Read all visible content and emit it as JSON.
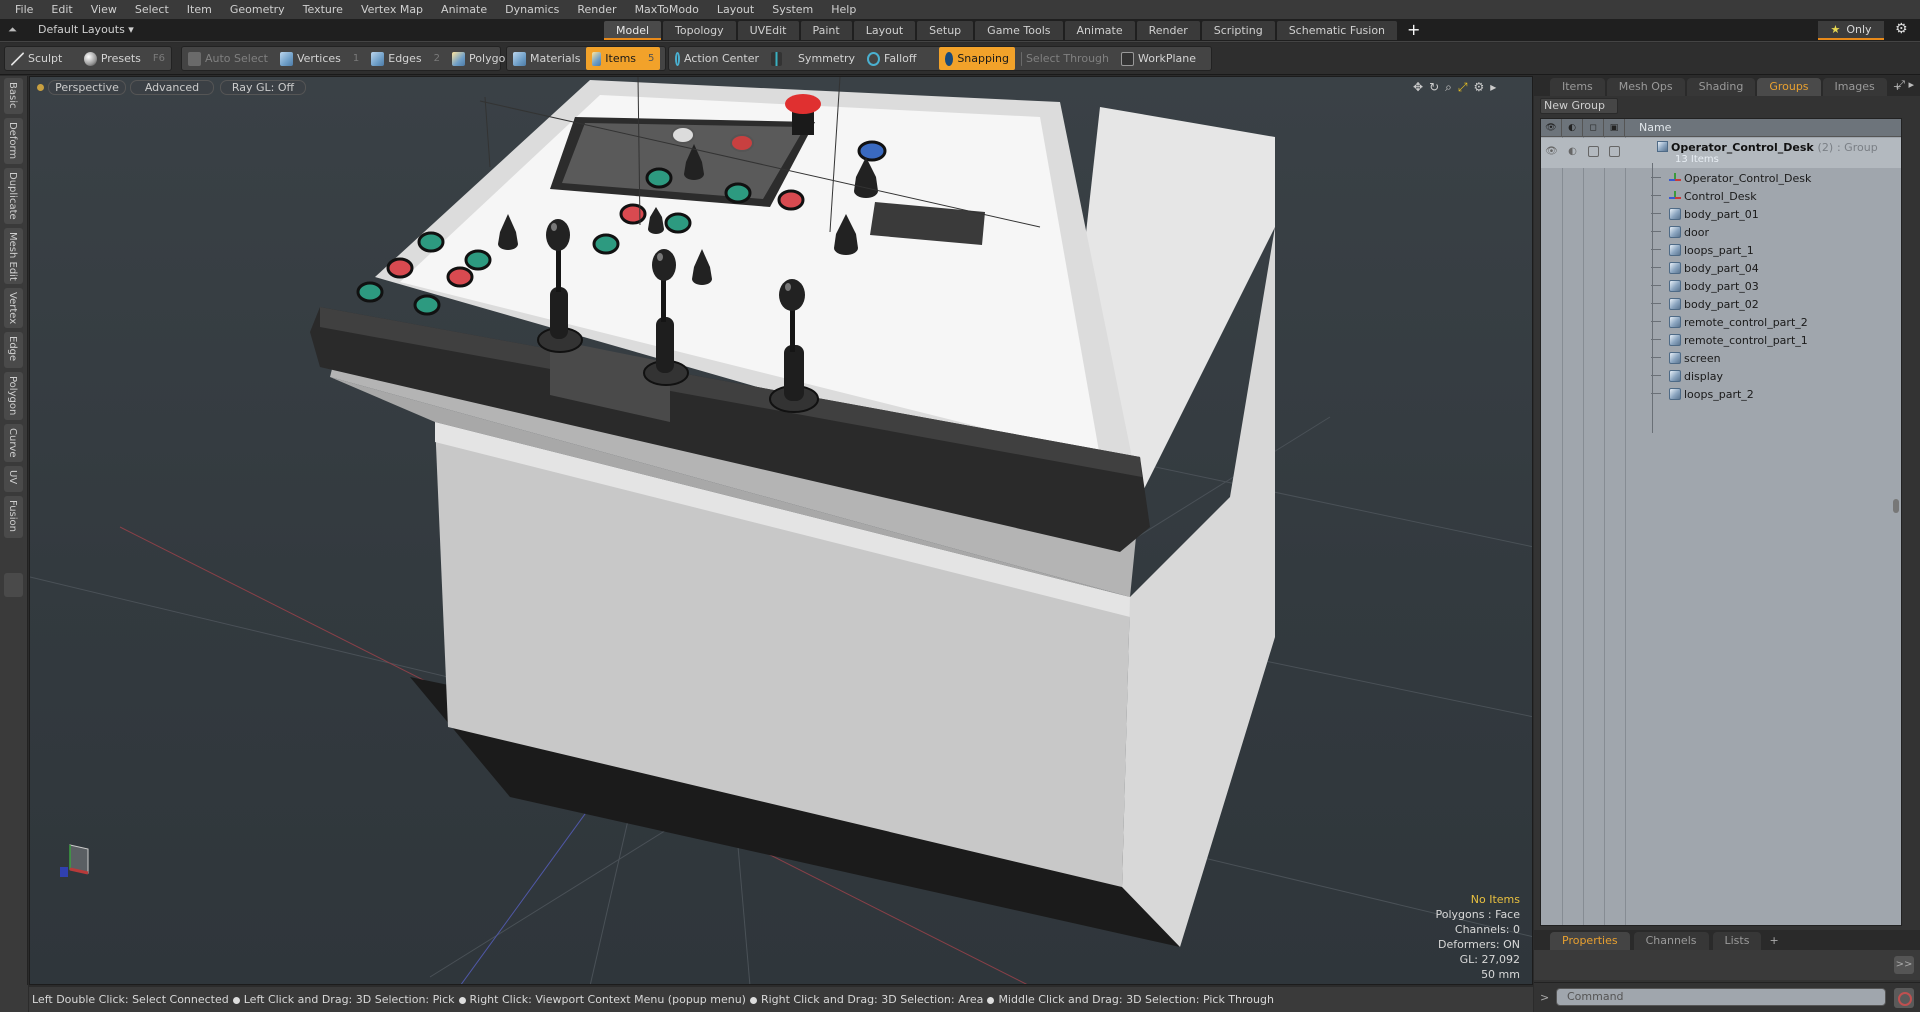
{
  "menubar": [
    "File",
    "Edit",
    "View",
    "Select",
    "Item",
    "Geometry",
    "Texture",
    "Vertex Map",
    "Animate",
    "Dynamics",
    "Render",
    "MaxToModo",
    "Layout",
    "System",
    "Help"
  ],
  "layout": {
    "selector": "Default Layouts ▾",
    "tabs": [
      "Model",
      "Topology",
      "UVEdit",
      "Paint",
      "Layout",
      "Setup",
      "Game Tools",
      "Animate",
      "Render",
      "Scripting",
      "Schematic Fusion"
    ],
    "active_tab": "Model",
    "add_tab": "+",
    "only_label": "Only",
    "icons": {
      "layout": "collapse-up-icon",
      "star": "star-icon",
      "gear": "gear-icon"
    }
  },
  "toolbar": {
    "sculpt": "Sculpt",
    "presets": "Presets",
    "presets_key": "F6",
    "auto_select": "Auto Select",
    "vertices": "Vertices",
    "vertices_key": "1",
    "edges": "Edges",
    "edges_key": "2",
    "polygons": "Polygons",
    "materials": "Materials",
    "items": "Items",
    "items_key": "5",
    "action_center": "Action Center",
    "symmetry": "Symmetry",
    "falloff": "Falloff",
    "snapping": "Snapping",
    "select_through": "Select Through",
    "workplane": "WorkPlane",
    "active_color": "#f2a22a"
  },
  "left_tabs": [
    "Basic",
    "Deform",
    "Duplicate",
    "Mesh Edit",
    "Vertex",
    "Edge",
    "Polygon",
    "Curve",
    "UV",
    "Fusion"
  ],
  "viewport": {
    "view_mode": "Perspective",
    "shading": "Advanced",
    "raygl": "Ray GL: Off",
    "info": {
      "selection": "No Items",
      "polygons": "Polygons : Face",
      "channels": "Channels: 0",
      "deformers": "Deformers: ON",
      "gl": "GL: 27,092",
      "focal": "50 mm"
    },
    "tool_icons": [
      "move-view-icon",
      "rotate-view-icon",
      "zoom-view-icon",
      "maximize-icon",
      "gear-icon",
      "arrow-right-icon"
    ]
  },
  "right_panel": {
    "tabs": [
      "Items",
      "Mesh Ops",
      "Shading",
      "Groups",
      "Images"
    ],
    "active_tab": "Groups",
    "new_group": "New Group",
    "name_header": "Name",
    "group": {
      "name": "Operator_Control_Desk",
      "count": "(2)",
      "type": ": Group",
      "sub": "13 Items"
    },
    "items": [
      {
        "name": "Operator_Control_Desk",
        "type": "locator"
      },
      {
        "name": "Control_Desk",
        "type": "locator"
      },
      {
        "name": "body_part_01",
        "type": "mesh"
      },
      {
        "name": "door",
        "type": "mesh"
      },
      {
        "name": "loops_part_1",
        "type": "mesh"
      },
      {
        "name": "body_part_04",
        "type": "mesh"
      },
      {
        "name": "body_part_03",
        "type": "mesh"
      },
      {
        "name": "body_part_02",
        "type": "mesh"
      },
      {
        "name": "remote_control_part_2",
        "type": "mesh"
      },
      {
        "name": "remote_control_part_1",
        "type": "mesh"
      },
      {
        "name": "screen",
        "type": "mesh"
      },
      {
        "name": "display",
        "type": "mesh"
      },
      {
        "name": "loops_part_2",
        "type": "mesh"
      }
    ],
    "bottom_tabs": [
      "Properties",
      "Channels",
      "Lists"
    ],
    "bottom_active": "Properties",
    "expand": ">>",
    "command_prompt": ">",
    "command_placeholder": "Command"
  },
  "statusbar": [
    "Left Double Click: Select Connected",
    "Left Click and Drag: 3D Selection: Pick",
    "Right Click: Viewport Context Menu (popup menu)",
    "Right Click and Drag: 3D Selection: Area",
    "Middle Click and Drag: 3D Selection: Pick Through"
  ]
}
